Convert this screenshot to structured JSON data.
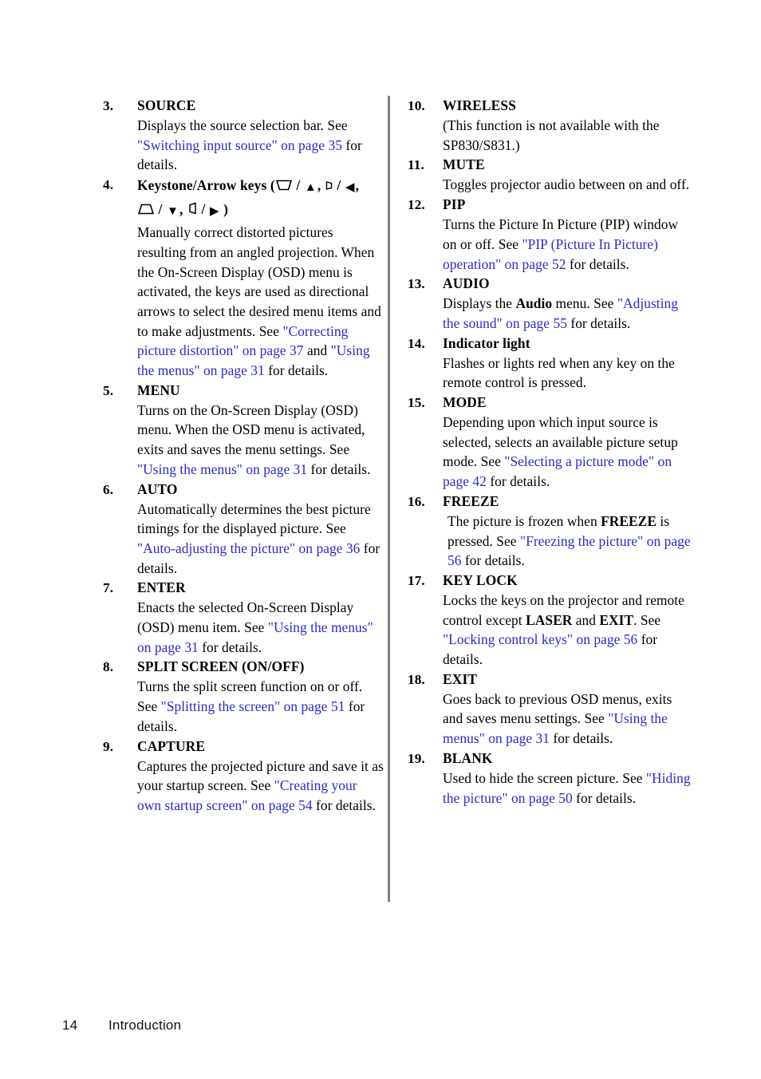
{
  "page": {
    "number": "14",
    "chapter": "Introduction",
    "link_color": "#2a2ac8",
    "divider_color": "#808080"
  },
  "left_column": {
    "items": [
      {
        "num": "3.",
        "title": "SOURCE",
        "body_parts": [
          {
            "t": "Displays the source selection bar. See ",
            "s": "plain"
          },
          {
            "t": "\"Switching input source\" on page 35",
            "s": "link"
          },
          {
            "t": " for details.",
            "s": "plain"
          }
        ]
      },
      {
        "num": "4.",
        "title": "Keystone/Arrow keys (",
        "title_suffix": ")",
        "glyph_line_1_sep": " / ",
        "glyph_line_comma": ", ",
        "body_parts": [
          {
            "t": "Manually correct distorted pictures resulting from an angled projection. When the On-Screen Display (OSD) menu is activated, the keys are used as directional arrows to select the desired menu items and to make adjustments. See ",
            "s": "plain"
          },
          {
            "t": "\"Correcting picture distortion\" on page 37",
            "s": "link"
          },
          {
            "t": " and ",
            "s": "plain"
          },
          {
            "t": "\"Using the menus\" on page 31",
            "s": "link"
          },
          {
            "t": " for details.",
            "s": "plain"
          }
        ],
        "glyphs": [
          "keystone-down-trapezoid",
          "arrow-up",
          "keystone-right-small",
          "arrow-left",
          "keystone-up-trapezoid",
          "arrow-down",
          "keystone-left-small",
          "arrow-right"
        ]
      },
      {
        "num": "5.",
        "title": "MENU",
        "body_parts": [
          {
            "t": "Turns on the On-Screen Display (OSD) menu. When the OSD menu is activated, exits and saves the menu settings. See ",
            "s": "plain"
          },
          {
            "t": "\"Using the menus\" on page 31",
            "s": "link"
          },
          {
            "t": " for details.",
            "s": "plain"
          }
        ]
      },
      {
        "num": "6.",
        "title": "AUTO",
        "body_parts": [
          {
            "t": "Automatically determines the best picture timings for the displayed picture. See ",
            "s": "plain"
          },
          {
            "t": "\"Auto-adjusting the picture\" on page 36",
            "s": "link"
          },
          {
            "t": " for details.",
            "s": "plain"
          }
        ]
      },
      {
        "num": "7.",
        "title": "ENTER",
        "body_parts": [
          {
            "t": "Enacts the selected On-Screen Display (OSD) menu item. See ",
            "s": "plain"
          },
          {
            "t": "\"Using the menus\" on page 31",
            "s": "link"
          },
          {
            "t": " for details.",
            "s": "plain"
          }
        ]
      },
      {
        "num": "8.",
        "title": "SPLIT SCREEN (ON/OFF)",
        "body_parts": [
          {
            "t": "Turns the split screen function on or off. See ",
            "s": "plain"
          },
          {
            "t": "\"Splitting the screen\" on page 51",
            "s": "link"
          },
          {
            "t": " for details.",
            "s": "plain"
          }
        ]
      },
      {
        "num": "9.",
        "title": "CAPTURE",
        "body_parts": [
          {
            "t": "Captures the projected picture and save it as your startup screen. See ",
            "s": "plain"
          },
          {
            "t": "\"Creating your own startup screen\" on page 54",
            "s": "link"
          },
          {
            "t": " for details.",
            "s": "plain"
          }
        ]
      }
    ]
  },
  "right_column": {
    "items": [
      {
        "num": "10.",
        "title": "WIRELESS",
        "body_parts": [
          {
            "t": "(This function is not available with the SP830/S831.)",
            "s": "plain"
          }
        ]
      },
      {
        "num": "11.",
        "title": "MUTE",
        "body_parts": [
          {
            "t": "Toggles projector audio between on and off.",
            "s": "plain"
          }
        ]
      },
      {
        "num": "12.",
        "title": "PIP",
        "body_parts": [
          {
            "t": "Turns the Picture In Picture (PIP) window on or off. See ",
            "s": "plain"
          },
          {
            "t": "\"PIP (Picture In Picture) operation\" on page 52",
            "s": "link"
          },
          {
            "t": " for details.",
            "s": "plain"
          }
        ]
      },
      {
        "num": "13.",
        "title": "AUDIO",
        "body_parts": [
          {
            "t": "Displays the ",
            "s": "plain"
          },
          {
            "t": "Audio",
            "s": "bold"
          },
          {
            "t": " menu. See ",
            "s": "plain"
          },
          {
            "t": "\"Adjusting the sound\" on page 55",
            "s": "link"
          },
          {
            "t": " for details.",
            "s": "plain"
          }
        ]
      },
      {
        "num": "14.",
        "title": "Indicator light",
        "body_parts": [
          {
            "t": "Flashes or lights red when any key on the remote control is pressed.",
            "s": "plain"
          }
        ]
      },
      {
        "num": "15.",
        "title": "MODE",
        "body_parts": [
          {
            "t": "Depending upon which input source is selected, selects an available picture setup mode. See ",
            "s": "plain"
          },
          {
            "t": "\"Selecting a picture mode\" on page 42",
            "s": "link"
          },
          {
            "t": " for details.",
            "s": "plain"
          }
        ]
      },
      {
        "num": "16.",
        "title": "FREEZE",
        "extra_indent": true,
        "body_parts": [
          {
            "t": "The picture is frozen when ",
            "s": "plain"
          },
          {
            "t": "FREEZE",
            "s": "bold"
          },
          {
            "t": " is pressed. See ",
            "s": "plain"
          },
          {
            "t": "\"Freezing the picture\" on page 56",
            "s": "link"
          },
          {
            "t": " for details.",
            "s": "plain"
          }
        ]
      },
      {
        "num": "17.",
        "title": "KEY LOCK",
        "body_parts": [
          {
            "t": "Locks the keys on the projector and remote control except ",
            "s": "plain"
          },
          {
            "t": "LASER",
            "s": "bold"
          },
          {
            "t": " and ",
            "s": "plain"
          },
          {
            "t": "EXIT",
            "s": "bold"
          },
          {
            "t": ". See ",
            "s": "plain"
          },
          {
            "t": "\"Locking control keys\" on page 56",
            "s": "link"
          },
          {
            "t": " for details.",
            "s": "plain"
          }
        ]
      },
      {
        "num": "18.",
        "title": "EXIT",
        "body_parts": [
          {
            "t": "Goes back to previous OSD menus, exits and saves menu settings. See ",
            "s": "plain"
          },
          {
            "t": "\"Using the menus\" on page 31",
            "s": "link"
          },
          {
            "t": " for details.",
            "s": "plain"
          }
        ]
      },
      {
        "num": "19.",
        "title": "BLANK",
        "body_parts": [
          {
            "t": "Used to hide the screen picture. See ",
            "s": "plain"
          },
          {
            "t": "\"Hiding the picture\" on page 50",
            "s": "link"
          },
          {
            "t": " for details.",
            "s": "plain"
          }
        ]
      }
    ]
  }
}
